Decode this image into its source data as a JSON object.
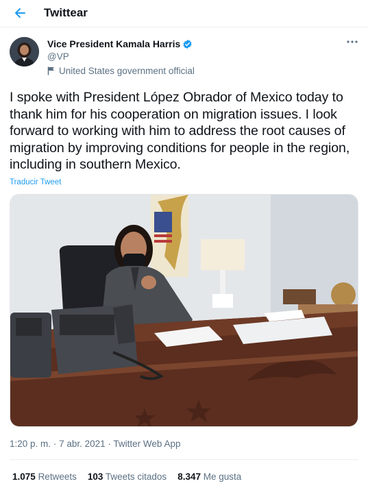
{
  "header": {
    "title": "Twittear",
    "back_icon": "arrow-left-icon",
    "accent_color": "#1d9bf0"
  },
  "author": {
    "display_name": "Vice President Kamala Harris",
    "handle": "@VP",
    "verified_icon": "verified-badge-icon",
    "label": "United States government official",
    "label_icon": "flag-icon"
  },
  "tweet": {
    "text": "I spoke with President López Obrador of Mexico today to thank him for his cooperation on migration issues. I look forward to working with him to address the root causes of migration by improving conditions for people in the region, including in southern Mexico.",
    "translate_label": "Traducir Tweet",
    "time": "1:20 p. m.",
    "date": "7 abr. 2021",
    "separator": "·",
    "source": "Twitter Web App"
  },
  "stats": {
    "retweets_count": "1.075",
    "retweets_label": "Retweets",
    "quotes_count": "103",
    "quotes_label": "Tweets citados",
    "likes_count": "8.347",
    "likes_label": "Me gusta"
  }
}
